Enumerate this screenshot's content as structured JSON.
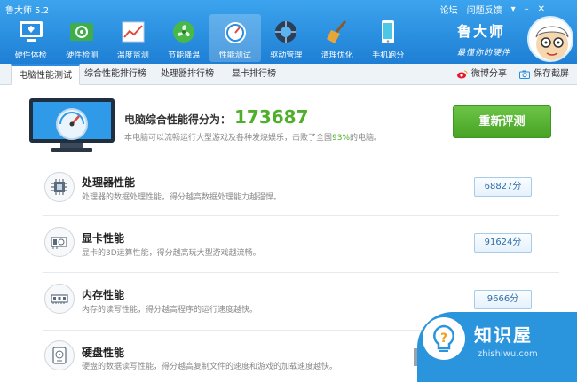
{
  "window": {
    "title": "鲁大师 5.2",
    "links": [
      "论坛",
      "问题反馈"
    ]
  },
  "toolbar": {
    "items": [
      {
        "label": "硬件体检",
        "icon": "hardware-checkup-icon"
      },
      {
        "label": "硬件检测",
        "icon": "hardware-detect-icon"
      },
      {
        "label": "温度监测",
        "icon": "temperature-monitor-icon"
      },
      {
        "label": "节能降温",
        "icon": "fan-icon"
      },
      {
        "label": "性能测试",
        "icon": "speedometer-icon",
        "active": true
      },
      {
        "label": "驱动管理",
        "icon": "driver-icon"
      },
      {
        "label": "清理优化",
        "icon": "broom-icon"
      },
      {
        "label": "手机跑分",
        "icon": "phone-icon"
      }
    ]
  },
  "brand": {
    "title": "鲁大师",
    "slogan": "最懂你的硬件"
  },
  "tabs": {
    "items": [
      "电脑性能测试",
      "综合性能排行榜",
      "处理器排行榜",
      "显卡排行榜"
    ],
    "share_label": "微博分享",
    "screenshot_label": "保存截屏"
  },
  "score": {
    "label": "电脑综合性能得分为：",
    "value": "173687",
    "desc_prefix": "本电脑可以流畅运行大型游戏及各种发烧娱乐，击败了全国",
    "percent": "93%",
    "desc_suffix": "的电脑。",
    "retest_label": "重新评测"
  },
  "rows": [
    {
      "title": "处理器性能",
      "desc": "处理器的数据处理性能，得分越高数据处理能力越强悍。",
      "score": "68827分",
      "icon": "cpu-icon"
    },
    {
      "title": "显卡性能",
      "desc": "显卡的3D运算性能，得分越高玩大型游戏越流畅。",
      "score": "91624分",
      "icon": "gpu-icon"
    },
    {
      "title": "内存性能",
      "desc": "内存的读写性能，得分越高程序的运行速度越快。",
      "score": "9666分",
      "icon": "memory-icon"
    },
    {
      "title": "硬盘性能",
      "desc": "硬盘的数据读写性能，得分越高复制文件的速度和游戏的加载速度越快。",
      "score": "",
      "icon": "disk-icon"
    }
  ],
  "watermark": {
    "title": "知识屋",
    "url": "zhishiwu.com"
  },
  "colors": {
    "header": "#1e7fd4",
    "score_green": "#4fae2a",
    "button_green": "#47a326",
    "badge_blue": "#2e6da8"
  }
}
